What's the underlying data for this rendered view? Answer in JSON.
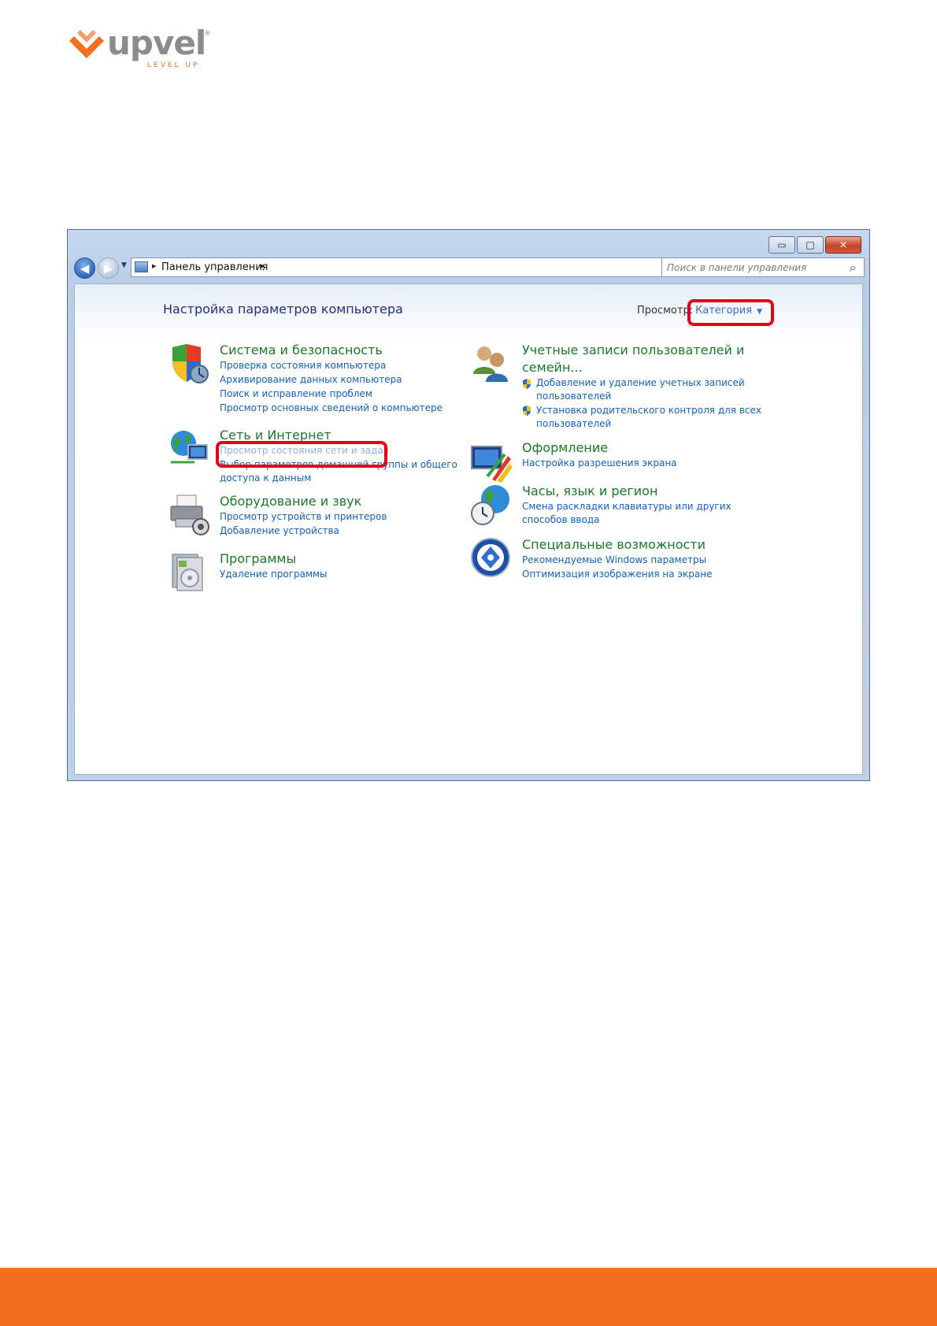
{
  "logo": {
    "name": "upvel",
    "tagline": "LEVEL UP",
    "registered": "®"
  },
  "window": {
    "caption_buttons": {
      "minimize": "▭",
      "maximize": "□",
      "close": "✕"
    },
    "nav": {
      "back": "◀",
      "forward": "▶",
      "history": "▼"
    },
    "address": {
      "chevron": "▸",
      "crumb": "Панель управления",
      "dropdown": "▼",
      "refresh": "↻"
    },
    "search": {
      "placeholder": "Поиск в панели управления",
      "icon": "⌕"
    }
  },
  "panel": {
    "title": "Настройка параметров компьютера",
    "view_label": "Просмотр:",
    "view_value": "Категория",
    "view_arrow": "▼"
  },
  "categories_left": [
    {
      "title": "Система и безопасность",
      "icon": "shield-icon",
      "links": [
        "Проверка состояния компьютера",
        "Архивирование данных компьютера",
        "Поиск и исправление проблем",
        "Просмотр основных сведений о компьютере"
      ]
    },
    {
      "title": "Сеть и Интернет",
      "icon": "network-globe-icon",
      "links": [
        "Просмотр состояния сети и задач",
        "Выбор параметров домашней группы и общего",
        "доступа к данным"
      ]
    },
    {
      "title": "Оборудование и звук",
      "icon": "printer-icon",
      "links": [
        "Просмотр устройств и принтеров",
        "Добавление устройства"
      ]
    },
    {
      "title": "Программы",
      "icon": "programs-icon",
      "links": [
        "Удаление программы"
      ]
    }
  ],
  "categories_right": [
    {
      "title_line1": "Учетные записи пользователей и",
      "title_line2": "семейн...",
      "icon": "users-icon",
      "links": [
        "Добавление и удаление учетных записей",
        "пользователей",
        "Установка родительского контроля для всех",
        "пользователей"
      ]
    },
    {
      "title": "Оформление",
      "icon": "appearance-icon",
      "links": [
        "Настройка разрешения экрана"
      ]
    },
    {
      "title": "Часы, язык и регион",
      "icon": "clock-globe-icon",
      "links": [
        "Смена раскладки клавиатуры или других",
        "способов ввода"
      ]
    },
    {
      "title": "Специальные возможности",
      "icon": "accessibility-icon",
      "links": [
        "Рекомендуемые Windows параметры",
        "Оптимизация изображения на экране"
      ]
    }
  ],
  "colors": {
    "brand_orange": "#f37021",
    "highlight_red": "#e4001b",
    "category_green": "#1a7a2a",
    "link_blue": "#1260c4"
  }
}
